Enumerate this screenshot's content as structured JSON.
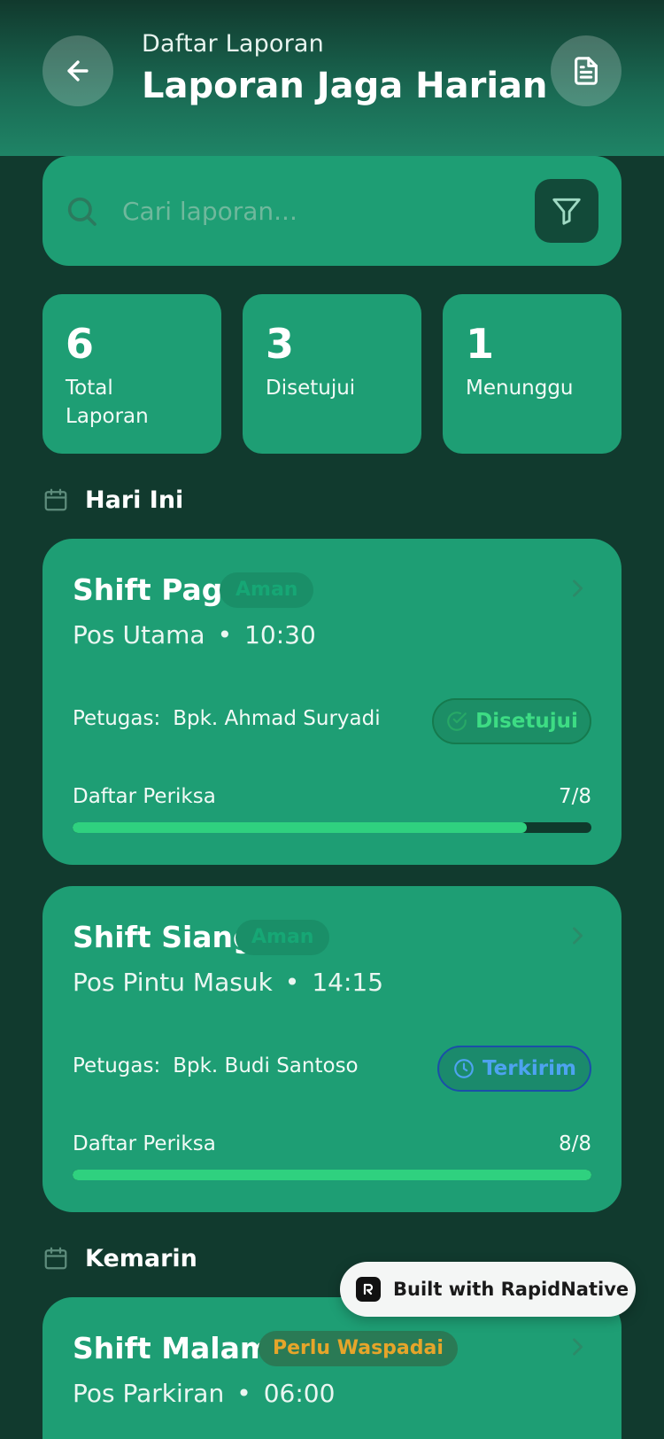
{
  "header": {
    "subtitle": "Daftar Laporan",
    "title": "Laporan Jaga Harian",
    "back_icon": "arrow-left-icon",
    "doc_icon": "document-icon"
  },
  "search": {
    "placeholder": "Cari laporan...",
    "value": ""
  },
  "stats": [
    {
      "value": "6",
      "label_line1": "Total",
      "label_line2": "Laporan"
    },
    {
      "value": "3",
      "label_line1": "Disetujui",
      "label_line2": ""
    },
    {
      "value": "1",
      "label_line1": "Menunggu",
      "label_line2": ""
    }
  ],
  "sections": {
    "today": "Hari Ini",
    "yesterday": "Kemarin"
  },
  "reports": [
    {
      "title": "Shift Pagi",
      "badge": "Aman",
      "location": "Pos Utama",
      "time": "10:30",
      "officer_label": "Petugas:",
      "officer": "Bpk. Ahmad Suryadi",
      "status": "Disetujui",
      "checklist_label": "Daftar Periksa",
      "checklist_count": "7/8",
      "progress": 0.875
    },
    {
      "title": "Shift Siang",
      "badge": "Aman",
      "location": "Pos Pintu Masuk",
      "time": "14:15",
      "officer_label": "Petugas:",
      "officer": "Bpk. Budi Santoso",
      "status": "Terkirim",
      "checklist_label": "Daftar Periksa",
      "checklist_count": "8/8",
      "progress": 1.0
    },
    {
      "title": "Shift Malam",
      "badge": "Perlu Waspadai",
      "location": "Pos Parkiran",
      "time": "06:00"
    }
  ],
  "toast": {
    "text": "Built with RapidNative"
  },
  "colors": {
    "background": "#113A2E",
    "card": "#1E9E74",
    "approved": "#3DDC84",
    "sent": "#4EA3F0",
    "warning": "#E6A52A",
    "progress": "#2FD17F"
  }
}
